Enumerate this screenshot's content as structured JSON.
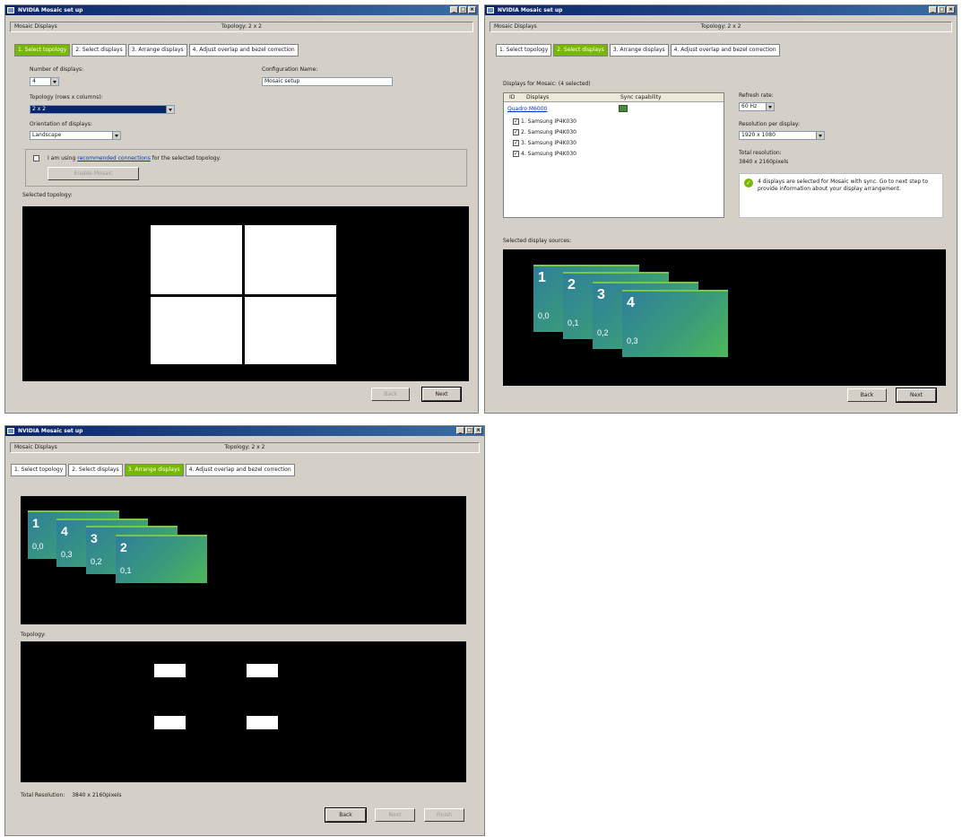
{
  "window_title": "NVIDIA Mosaic set up",
  "header_left": "Mosaic Displays",
  "topology": "Topology: 2 x 2",
  "tabs": [
    "1. Select topology",
    "2. Select displays",
    "3. Arrange displays",
    "4. Adjust overlap and bezel correction"
  ],
  "step1": {
    "num_displays_label": "Number of displays:",
    "num_displays_value": "4",
    "config_name_label": "Configuration Name:",
    "config_name_value": "Mosaic setup",
    "topology_label": "Topology (rows x columns):",
    "topology_value": "2 x 2",
    "orientation_label": "Orientation of displays:",
    "orientation_value": "Landscape",
    "recommended_prefix": "I am using",
    "recommended_link": "recommended connections",
    "recommended_suffix": "for the selected topology.",
    "enable_button": "Enable Mosaic",
    "selected_topology_label": "Selected topology:",
    "back": "Back",
    "next": "Next"
  },
  "step2": {
    "displays_label": "Displays for Mosaic: (4 selected)",
    "col_id": "ID",
    "col_displays": "Displays",
    "col_sync": "Sync capability",
    "gpu": "Quadro M6000",
    "displays": [
      "1. Samsung IP4K030",
      "2. Samsung IP4K030",
      "3. Samsung IP4K030",
      "4. Samsung IP4K030"
    ],
    "refresh_label": "Refresh rate:",
    "refresh_value": "60 Hz",
    "resolution_label": "Resolution per display:",
    "resolution_value": "1920 x 1080",
    "total_label": "Total resolution:",
    "total_value": "3840 x 2160pixels",
    "info": "4 displays are selected for Mosaic with sync. Go to next step to provide information about your display arrangement.",
    "sources_label": "Selected display sources:",
    "back": "Back",
    "next": "Next"
  },
  "step2_cards": [
    {
      "n": "1",
      "s": "0,0"
    },
    {
      "n": "2",
      "s": "0,1"
    },
    {
      "n": "3",
      "s": "0,2"
    },
    {
      "n": "4",
      "s": "0,3"
    }
  ],
  "step3": {
    "topology_label": "Topology:",
    "total_label": "Total Resolution:",
    "total_value": "3840 x 2160pixels",
    "back": "Back",
    "next": "Next",
    "finish": "Finish"
  },
  "step3_cards": [
    {
      "n": "1",
      "s": "0,0"
    },
    {
      "n": "4",
      "s": "0,3"
    },
    {
      "n": "3",
      "s": "0,2"
    },
    {
      "n": "2",
      "s": "0,1"
    }
  ],
  "colors": {
    "nvidia_green": "#76b900",
    "titlebar": "#0a246a"
  }
}
